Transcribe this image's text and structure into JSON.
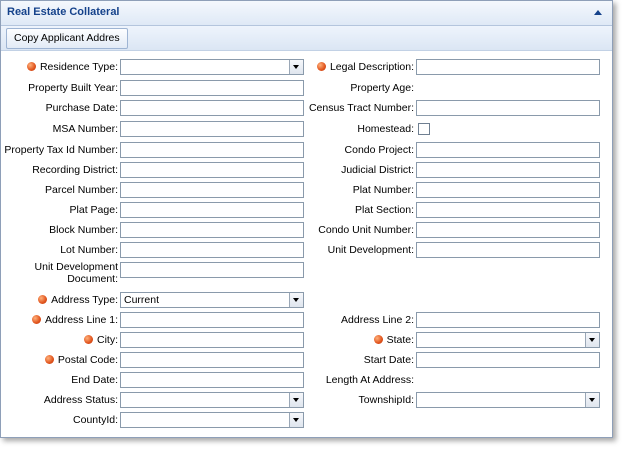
{
  "panel": {
    "title": "Real Estate Collateral",
    "collapse_icon": "collapse-up-icon",
    "copy_button_label": "Copy Applicant Addres"
  },
  "colors": {
    "header_text": "#15428b",
    "required_dot": "#e0531c",
    "field_border": "#8a9aab"
  },
  "rows": [
    {
      "left": {
        "label": "Residence Type:",
        "required": true,
        "type": "select",
        "value": ""
      },
      "right": {
        "label": "Legal Description:",
        "required": true,
        "type": "text",
        "value": ""
      }
    },
    {
      "left": {
        "label": "Property Built Year:",
        "type": "text",
        "value": ""
      },
      "right": {
        "label": "Property Age:",
        "type": "none"
      }
    },
    {
      "left": {
        "label": "Purchase Date:",
        "type": "text",
        "value": ""
      },
      "right": {
        "label": "Census Tract Number:",
        "type": "text",
        "value": ""
      }
    },
    {
      "left": {
        "label": "MSA Number:",
        "type": "text",
        "value": ""
      },
      "right": {
        "label": "Homestead:",
        "type": "checkbox",
        "checked": false
      }
    },
    {
      "left": {
        "label": "Property Tax Id Number:",
        "type": "text",
        "value": ""
      },
      "right": {
        "label": "Condo Project:",
        "type": "text",
        "value": ""
      }
    },
    {
      "left": {
        "label": "Recording District:",
        "type": "text",
        "value": ""
      },
      "right": {
        "label": "Judicial District:",
        "type": "text",
        "value": ""
      }
    },
    {
      "left": {
        "label": "Parcel Number:",
        "type": "text",
        "value": ""
      },
      "right": {
        "label": "Plat Number:",
        "type": "text",
        "value": ""
      }
    },
    {
      "left": {
        "label": "Plat Page:",
        "type": "text",
        "value": ""
      },
      "right": {
        "label": "Plat Section:",
        "type": "text",
        "value": ""
      }
    },
    {
      "left": {
        "label": "Block Number:",
        "type": "text",
        "value": ""
      },
      "right": {
        "label": "Condo Unit Number:",
        "type": "text",
        "value": ""
      }
    },
    {
      "left": {
        "label": "Lot Number:",
        "type": "text",
        "value": ""
      },
      "right": {
        "label": "Unit Development:",
        "type": "text",
        "value": ""
      }
    },
    {
      "left": {
        "label": "Unit Development Document:",
        "type": "text",
        "value": ""
      },
      "right": null
    },
    {
      "left": {
        "label": "Address Type:",
        "required": true,
        "type": "select",
        "value": "Current"
      },
      "right": null
    },
    {
      "left": {
        "label": "Address Line 1:",
        "required": true,
        "type": "text",
        "value": ""
      },
      "right": {
        "label": "Address Line 2:",
        "type": "text",
        "value": ""
      }
    },
    {
      "left": {
        "label": "City:",
        "required": true,
        "type": "text",
        "value": ""
      },
      "right": {
        "label": "State:",
        "required": true,
        "type": "select",
        "value": ""
      }
    },
    {
      "left": {
        "label": "Postal Code:",
        "required": true,
        "type": "text",
        "value": ""
      },
      "right": {
        "label": "Start Date:",
        "type": "text",
        "value": ""
      }
    },
    {
      "left": {
        "label": "End Date:",
        "type": "text",
        "value": ""
      },
      "right": {
        "label": "Length At Address:",
        "type": "none"
      }
    },
    {
      "left": {
        "label": "Address Status:",
        "type": "select",
        "value": ""
      },
      "right": {
        "label": "TownshipId:",
        "type": "select",
        "value": ""
      }
    },
    {
      "left": {
        "label": "CountyId:",
        "type": "select",
        "value": ""
      },
      "right": null
    }
  ]
}
